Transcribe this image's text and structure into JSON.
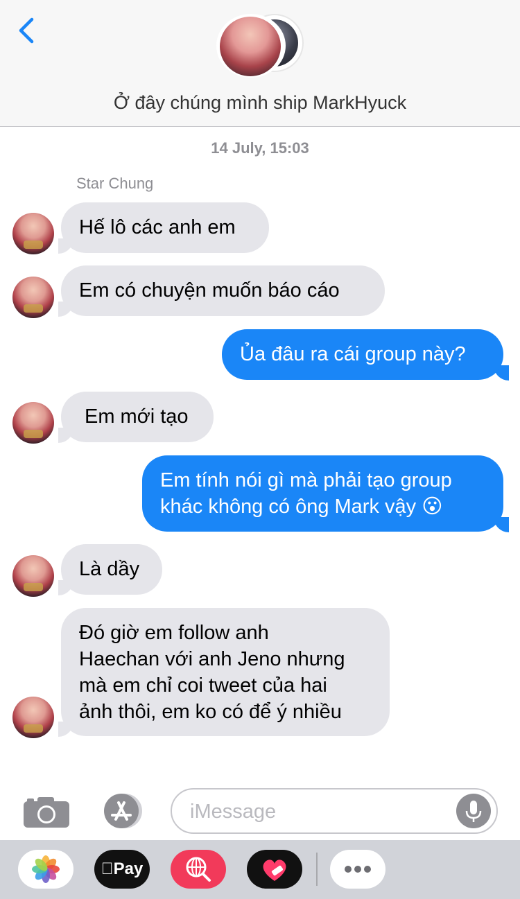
{
  "header": {
    "title": "Ở đây chúng mình ship MarkHyuck"
  },
  "timestamp": "14 July, 15:03",
  "sender_name": "Star Chung",
  "messages": [
    {
      "from": "them",
      "text": "Hế lô các anh em"
    },
    {
      "from": "them",
      "text": "Em có chuyện muốn báo cáo"
    },
    {
      "from": "me",
      "text": "Ủa đâu ra cái group này?"
    },
    {
      "from": "them",
      "text": "Em mới tạo"
    },
    {
      "from": "me",
      "lines": [
        "Em tính nói gì mà phải tạo group",
        "khác không có ông Mark vậy 😮"
      ]
    },
    {
      "from": "them",
      "text": "Là dầy"
    },
    {
      "from": "them",
      "lines": [
        "Đó giờ em follow anh",
        "Haechan với anh Jeno nhưng",
        "mà em chỉ coi tweet của hai",
        "ảnh thôi, em ko có để ý nhiều"
      ]
    }
  ],
  "input": {
    "placeholder": "iMessage"
  },
  "app_drawer": {
    "pay_label": "Pay",
    "apps": [
      "photos-app-icon",
      "apple-pay-app-icon",
      "web-search-app-icon",
      "digital-touch-app-icon",
      "more-apps-icon"
    ]
  },
  "colors": {
    "outgoing_bubble": "#1a86f7",
    "incoming_bubble": "#e5e5ea",
    "accent": "#1a86f7"
  }
}
